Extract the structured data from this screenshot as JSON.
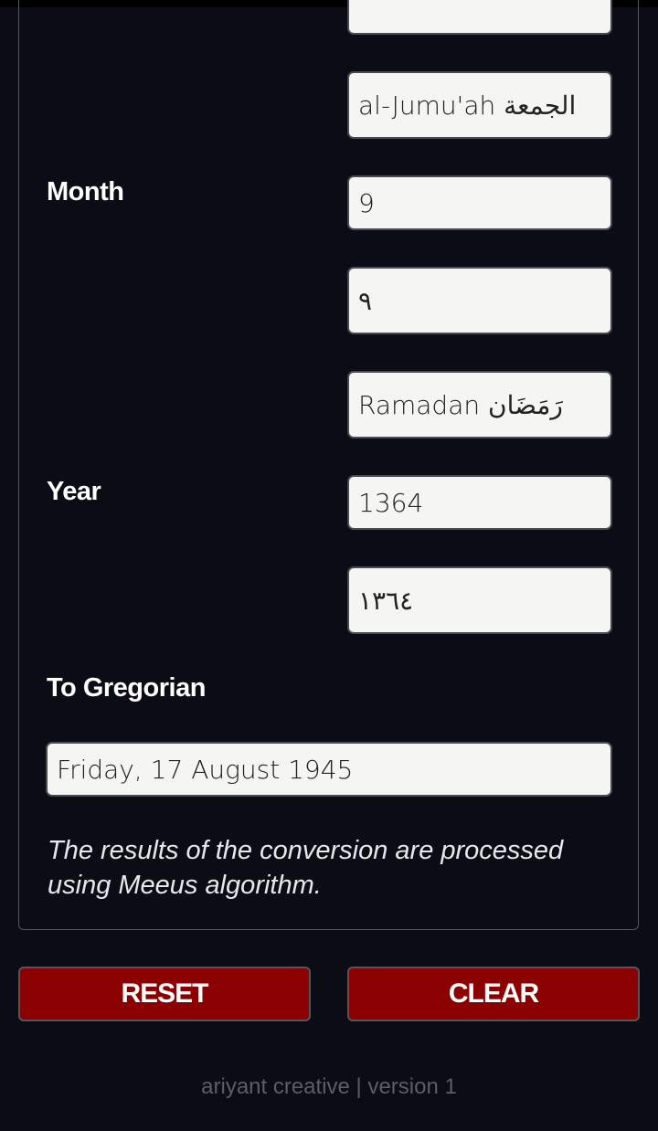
{
  "form": {
    "day_name_value": "al-Jumu'ah الجمعة",
    "month_label": "Month",
    "month_value": "9",
    "month_arabic_numeral": "٩",
    "month_name_value": "Ramadan رَمَضَان",
    "year_label": "Year",
    "year_value": "1364",
    "year_arabic_numeral": "١٣٦٤",
    "to_gregorian_label": "To Gregorian",
    "gregorian_result": "Friday, 17 August 1945",
    "note": "The results of the conversion are processed using Meeus algorithm."
  },
  "buttons": {
    "reset": "RESET",
    "clear": "CLEAR"
  },
  "footer": "ariyant creative | version 1"
}
